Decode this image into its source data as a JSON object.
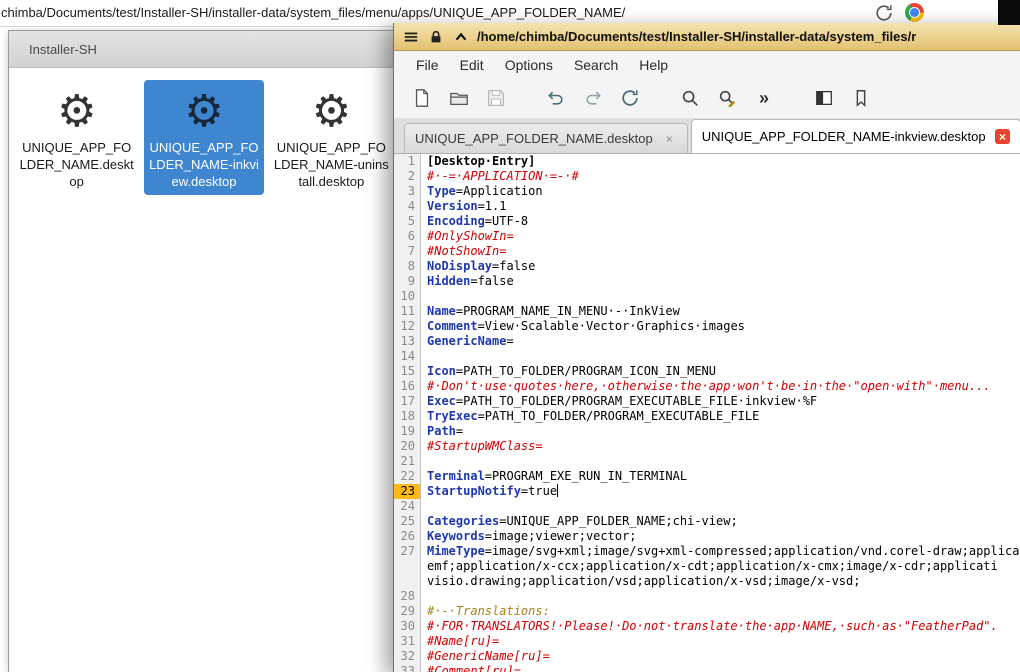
{
  "address_bar": {
    "path": "chimba/Documents/test/Installer-SH/installer-data/system_files/menu/apps/UNIQUE_APP_FOLDER_NAME/"
  },
  "file_manager": {
    "title": "Installer-SH",
    "items": [
      {
        "name": "UNIQUE_APP_FOLDER_NAME.desktop",
        "selected": false
      },
      {
        "name": "UNIQUE_APP_FOLDER_NAME-inkview.desktop",
        "selected": true
      },
      {
        "name": "UNIQUE_APP_FOLDER_NAME-uninstall.desktop",
        "selected": false
      }
    ]
  },
  "editor": {
    "window_title": "/home/chimba/Documents/test/Installer-SH/installer-data/system_files/r",
    "menus": [
      "File",
      "Edit",
      "Options",
      "Search",
      "Help"
    ],
    "toolbar_icons": [
      "new-file",
      "open-folder",
      "save",
      "undo",
      "redo",
      "reload",
      "search",
      "find-replace",
      "overflow-menu",
      "side-pane",
      "bookmark"
    ],
    "tabs": [
      {
        "label": "UNIQUE_APP_FOLDER_NAME.desktop",
        "active": false
      },
      {
        "label": "UNIQUE_APP_FOLDER_NAME-inkview.desktop",
        "active": true
      }
    ],
    "current_line": "23",
    "show_space_dots": true,
    "lines": [
      {
        "n": "1",
        "s": [
          [
            "sec",
            "[Desktop Entry]"
          ]
        ]
      },
      {
        "n": "2",
        "s": [
          [
            "c",
            "# -= APPLICATION =- #"
          ]
        ]
      },
      {
        "n": "3",
        "s": [
          [
            "k",
            "Type"
          ],
          [
            "v",
            "=Application"
          ]
        ]
      },
      {
        "n": "4",
        "s": [
          [
            "k",
            "Version"
          ],
          [
            "v",
            "=1.1"
          ]
        ]
      },
      {
        "n": "5",
        "s": [
          [
            "k",
            "Encoding"
          ],
          [
            "v",
            "=UTF-8"
          ]
        ]
      },
      {
        "n": "6",
        "s": [
          [
            "c",
            "#OnlyShowIn="
          ]
        ]
      },
      {
        "n": "7",
        "s": [
          [
            "c",
            "#NotShowIn="
          ]
        ]
      },
      {
        "n": "8",
        "s": [
          [
            "k",
            "NoDisplay"
          ],
          [
            "v",
            "=false"
          ]
        ]
      },
      {
        "n": "9",
        "s": [
          [
            "k",
            "Hidden"
          ],
          [
            "v",
            "=false"
          ]
        ]
      },
      {
        "n": "10",
        "s": []
      },
      {
        "n": "11",
        "s": [
          [
            "k",
            "Name"
          ],
          [
            "v",
            "=PROGRAM_NAME_IN_MENU - InkView"
          ]
        ]
      },
      {
        "n": "12",
        "s": [
          [
            "k",
            "Comment"
          ],
          [
            "v",
            "=View Scalable Vector Graphics images"
          ]
        ]
      },
      {
        "n": "13",
        "s": [
          [
            "k",
            "GenericName"
          ],
          [
            "v",
            "="
          ]
        ]
      },
      {
        "n": "14",
        "s": []
      },
      {
        "n": "15",
        "s": [
          [
            "k",
            "Icon"
          ],
          [
            "v",
            "=PATH_TO_FOLDER/PROGRAM_ICON_IN_MENU"
          ]
        ]
      },
      {
        "n": "16",
        "s": [
          [
            "c",
            "# Don't use quotes here, otherwise the app won't be in the \"open with\" menu..."
          ]
        ]
      },
      {
        "n": "17",
        "s": [
          [
            "k",
            "Exec"
          ],
          [
            "v",
            "=PATH_TO_FOLDER/PROGRAM_EXECUTABLE_FILE inkview %F"
          ]
        ]
      },
      {
        "n": "18",
        "s": [
          [
            "k",
            "TryExec"
          ],
          [
            "v",
            "=PATH_TO_FOLDER/PROGRAM_EXECUTABLE_FILE"
          ]
        ]
      },
      {
        "n": "19",
        "s": [
          [
            "k",
            "Path"
          ],
          [
            "v",
            "="
          ]
        ]
      },
      {
        "n": "20",
        "s": [
          [
            "c",
            "#StartupWMClass="
          ]
        ]
      },
      {
        "n": "21",
        "s": []
      },
      {
        "n": "22",
        "s": [
          [
            "k",
            "Terminal"
          ],
          [
            "v",
            "=PROGRAM_EXE_RUN_IN_TERMINAL"
          ]
        ]
      },
      {
        "n": "23",
        "cur": true,
        "s": [
          [
            "k",
            "StartupNotify"
          ],
          [
            "v",
            "=true"
          ]
        ]
      },
      {
        "n": "24",
        "s": []
      },
      {
        "n": "25",
        "s": [
          [
            "k",
            "Categories"
          ],
          [
            "v",
            "=UNIQUE_APP_FOLDER_NAME;chi-view;"
          ]
        ]
      },
      {
        "n": "26",
        "s": [
          [
            "k",
            "Keywords"
          ],
          [
            "v",
            "=image;viewer;vector;"
          ]
        ]
      },
      {
        "n": "27",
        "s": [
          [
            "k",
            "MimeType"
          ],
          [
            "v",
            "=image/svg+xml;image/svg+xml-compressed;application/vnd.corel-draw;applicati"
          ]
        ]
      },
      {
        "n": "",
        "s": [
          [
            "v",
            "emf;application/x-ccx;application/x-cdt;application/x-cmx;image/x-cdr;applicati"
          ]
        ]
      },
      {
        "n": "",
        "s": [
          [
            "v",
            "visio.drawing;application/vsd;application/x-vsd;image/x-vsd;"
          ]
        ]
      },
      {
        "n": "28",
        "s": []
      },
      {
        "n": "29",
        "s": [
          [
            "c2",
            "# - Translations:"
          ]
        ]
      },
      {
        "n": "30",
        "s": [
          [
            "c",
            "# FOR TRANSLATORS! Please! Do not translate the app NAME, such as \"FeatherPad\"."
          ]
        ]
      },
      {
        "n": "31",
        "s": [
          [
            "c",
            "#Name[ru]="
          ]
        ]
      },
      {
        "n": "32",
        "s": [
          [
            "c",
            "#GenericName[ru]="
          ]
        ]
      },
      {
        "n": "33",
        "s": [
          [
            "c",
            "#Comment[ru]="
          ]
        ]
      }
    ]
  },
  "colors": {
    "selection_blue": "#3e86d0",
    "current_line_yellow": "#fdb917",
    "comment_red": "#d10000",
    "key_blue": "#1f37b0",
    "titlebar_tan": "#ecd79c",
    "tab_close_red": "#e8432c"
  }
}
